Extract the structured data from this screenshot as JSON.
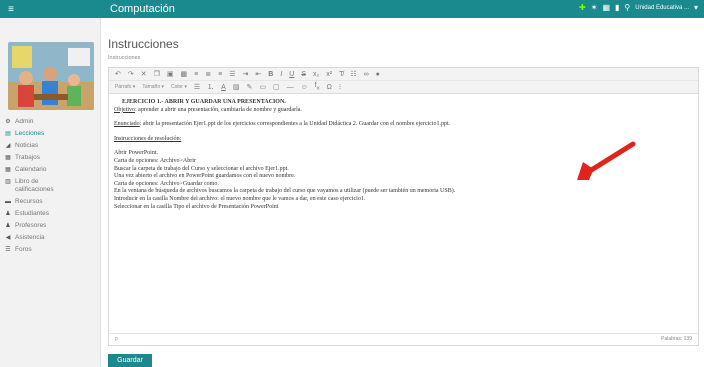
{
  "header": {
    "title": "Computación",
    "school": "Unidad Educativa ...",
    "icons": [
      "puzzle-icon",
      "bell-icon",
      "grid-icon",
      "bookmark-icon",
      "search-icon",
      "user-icon"
    ]
  },
  "sidebar": {
    "items": [
      {
        "label": "Admin",
        "icon": "gear-icon",
        "glyph": "⚙",
        "active": false
      },
      {
        "label": "Lecciones",
        "icon": "book-icon",
        "glyph": "▤",
        "active": true
      },
      {
        "label": "Noticias",
        "icon": "megaphone-icon",
        "glyph": "◢",
        "active": false
      },
      {
        "label": "Trabajos",
        "icon": "document-icon",
        "glyph": "▦",
        "active": false
      },
      {
        "label": "Calendario",
        "icon": "calendar-icon",
        "glyph": "▦",
        "active": false
      },
      {
        "label": "Libro de calificaciones",
        "icon": "gradebook-icon",
        "glyph": "▥",
        "active": false
      },
      {
        "label": "Recursos",
        "icon": "folder-icon",
        "glyph": "▬",
        "active": false
      },
      {
        "label": "Estudiantes",
        "icon": "student-icon",
        "glyph": "♟",
        "active": false
      },
      {
        "label": "Profesores",
        "icon": "teacher-icon",
        "glyph": "♟",
        "active": false
      },
      {
        "label": "Asistencia",
        "icon": "attendance-icon",
        "glyph": "◀",
        "active": false
      },
      {
        "label": "Foros",
        "icon": "forum-icon",
        "glyph": "☰",
        "active": false
      }
    ]
  },
  "page": {
    "title": "Instrucciones",
    "field_label": "Instrucciones"
  },
  "editor": {
    "format_select": "Párrafo",
    "size_select": "Tamaño",
    "color_select": "Color",
    "status_path": "p",
    "word_count": "Palabras: 139",
    "content": {
      "heading": "EJERCICIO 1.- ABRIR Y GUARDAR UNA PRESENTACION.",
      "objetivo_label": "Objetivo",
      "objetivo_text": ": aprender a abrir una presentación, cambiarla de nombre y guardarla.",
      "enunciado_label": "Enunciado",
      "enunciado_text": ": abrir la presentación Ejer1.ppt de los ejercicios correspondientes a la Unidad Didáctica 2. Guardar con el nombre ejercicio1.ppt.",
      "instr_label": "Instrucciones de resolución:",
      "steps": [
        "Abrir PowerPoint.",
        "Carta de opciones: Archivo>Abrir",
        "Buscar la carpeta de trabajo del Curso y seleccionar el archivo Ejer1.ppt.",
        "Una vez abierto el archivo en PowerPoint guardamos con el nuevo nombre.",
        "Carta de opciones: Archivo>Guardar como.",
        "En la ventana de búsqueda de archivos buscamos la carpeta de trabajo del curso que vayamos a utilizar (puede ser también un memoria USB).",
        "Introducir en la casilla Nombre del archivo: el nuevo nombre que le vamos a dar, en este caso ejercicio1.",
        "Seleccionar en la casilla Tipo el archivo de Presentación PowerPoint"
      ]
    }
  },
  "actions": {
    "save_label": "Guardar"
  },
  "colors": {
    "brand": "#1b8a8f",
    "arrow": "#e0241b"
  }
}
